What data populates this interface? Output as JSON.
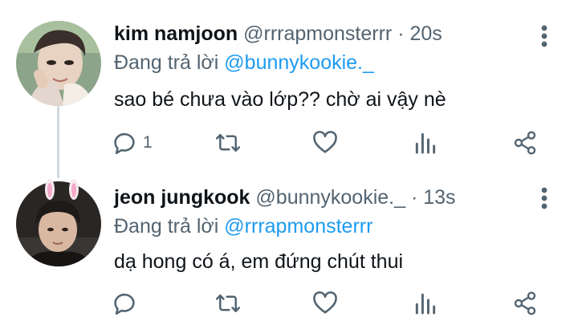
{
  "tweets": [
    {
      "name": "kim namjoon",
      "handle": "@rrrapmonsterrr",
      "sep": "·",
      "time": "20s",
      "replying_prefix": "Đang trả lời",
      "replying_to": "@bunnykookie._",
      "text": "sao bé chưa vào lớp?? chờ ai vậy nè",
      "reply_count": "1",
      "avatar_icon": "avatar-namjoon"
    },
    {
      "name": "jeon jungkook",
      "handle": "@bunnykookie._",
      "sep": "·",
      "time": "13s",
      "replying_prefix": "Đang trả lời",
      "replying_to": "@rrrapmonsterrr",
      "text": "dạ hong có á, em đứng chút thui",
      "reply_count": "",
      "avatar_icon": "avatar-jungkook"
    }
  ],
  "icons": {
    "reply": "reply-icon",
    "retweet": "retweet-icon",
    "like": "like-icon",
    "views": "views-icon",
    "share": "share-icon",
    "more": "more-icon"
  },
  "colors": {
    "link": "#1d9bf0",
    "secondary": "#536471",
    "icon": "#536471",
    "thread_line": "#cfd9de"
  }
}
